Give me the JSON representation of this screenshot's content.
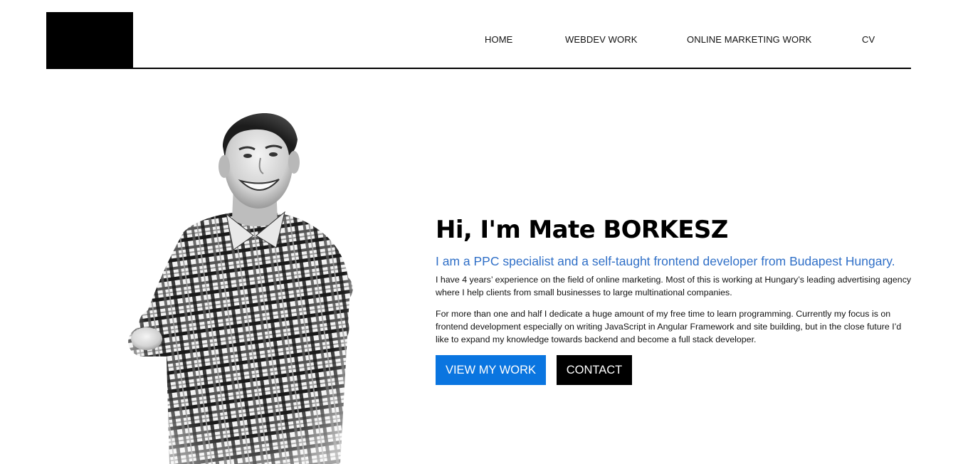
{
  "header": {
    "nav": [
      {
        "label": "HOME"
      },
      {
        "label": "WEBDEV WORK"
      },
      {
        "label": "ONLINE MARKETING WORK"
      },
      {
        "label": "CV"
      }
    ]
  },
  "hero": {
    "title": "Hi, I'm Mate BORKESZ",
    "subtitle": "I am a PPC specialist and a self-taught frontend developer from Budapest Hungary.",
    "paragraphs": [
      "I have 4 years’ experience on the field of online marketing. Most of this is working at Hungary’s leading advertising agency where I help clients from small businesses to large multinational companies.",
      "For more than one and half I dedicate a huge amount of my free time to learn programming. Currently my focus is on frontend development especially on writing JavaScript in Angular Framework and site building, but in the close future I’d like to expand my knowledge towards backend and become a full stack developer."
    ],
    "buttons": {
      "view_work": "VIEW MY WORK",
      "contact": "CONTACT"
    }
  },
  "colors": {
    "accent": "#0a75e0",
    "subtitle": "#2f6fc7",
    "dark": "#000000"
  }
}
